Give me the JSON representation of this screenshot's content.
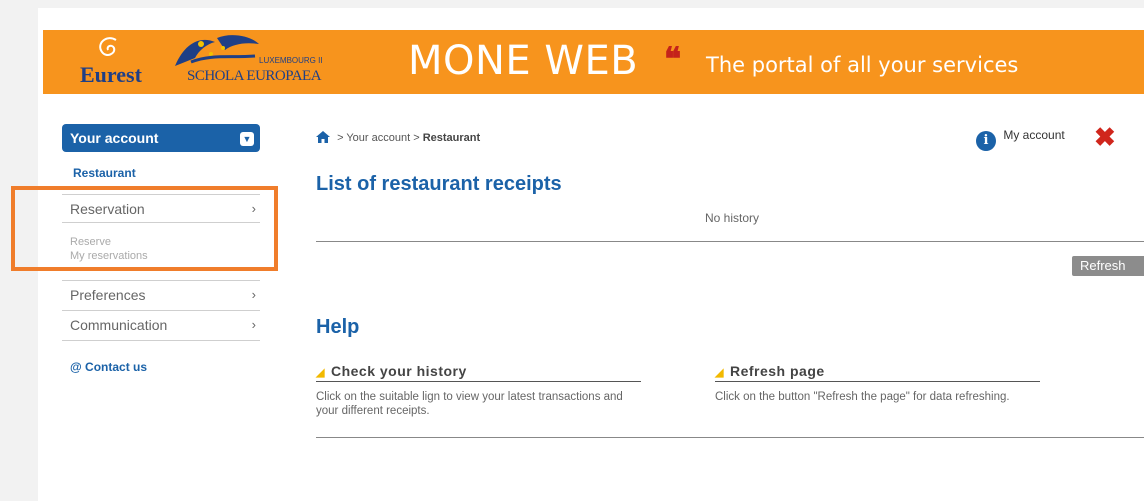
{
  "banner": {
    "eurest_logo": "Eurest",
    "school_logo_small": "LUXEMBOURG II",
    "school_logo": "SCHOLA EUROPAEA",
    "title": "MONE WEB",
    "quote_mark": "❝",
    "subtitle": "The portal of all your services"
  },
  "sidebar": {
    "account_header": "Your account",
    "restaurant_link": "Restaurant",
    "reservation": "Reservation",
    "reserve": "Reserve",
    "my_reservations": "My reservations",
    "preferences": "Preferences",
    "communication": "Communication",
    "contact": "@ Contact us"
  },
  "breadcrumb": {
    "sep1": "> Your account >",
    "current": "Restaurant"
  },
  "header_links": {
    "my_account": "My account"
  },
  "main": {
    "receipts_title": "List of restaurant receipts",
    "no_history": "No history",
    "refresh_button": "Refresh",
    "help_title": "Help",
    "help_items": [
      {
        "title": "Check your history",
        "desc": "Click on the suitable lign to view your latest transactions and your different receipts."
      },
      {
        "title": "Refresh page",
        "desc": "Click on the button \"Refresh the page\" for data refreshing."
      }
    ]
  },
  "colors": {
    "banner": "#f7941d",
    "primary": "#1b62a8",
    "highlight": "#f07d2b",
    "close": "#d0261c"
  }
}
